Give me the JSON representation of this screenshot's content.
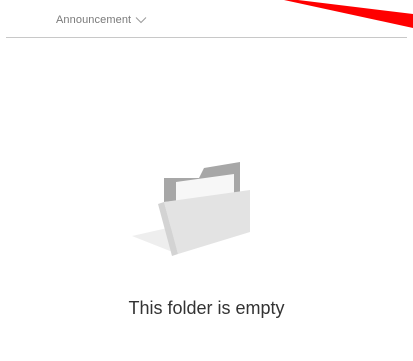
{
  "list": {
    "column_header": {
      "label": "Announcement",
      "icon": "chevron-down-icon"
    },
    "empty_state": {
      "icon": "empty-folder-icon",
      "message": "This folder is empty"
    }
  },
  "colors": {
    "annotation": "#ff0000",
    "divider": "#c8c8c8",
    "header_text": "#7a7a7a",
    "message_text": "#333333"
  }
}
